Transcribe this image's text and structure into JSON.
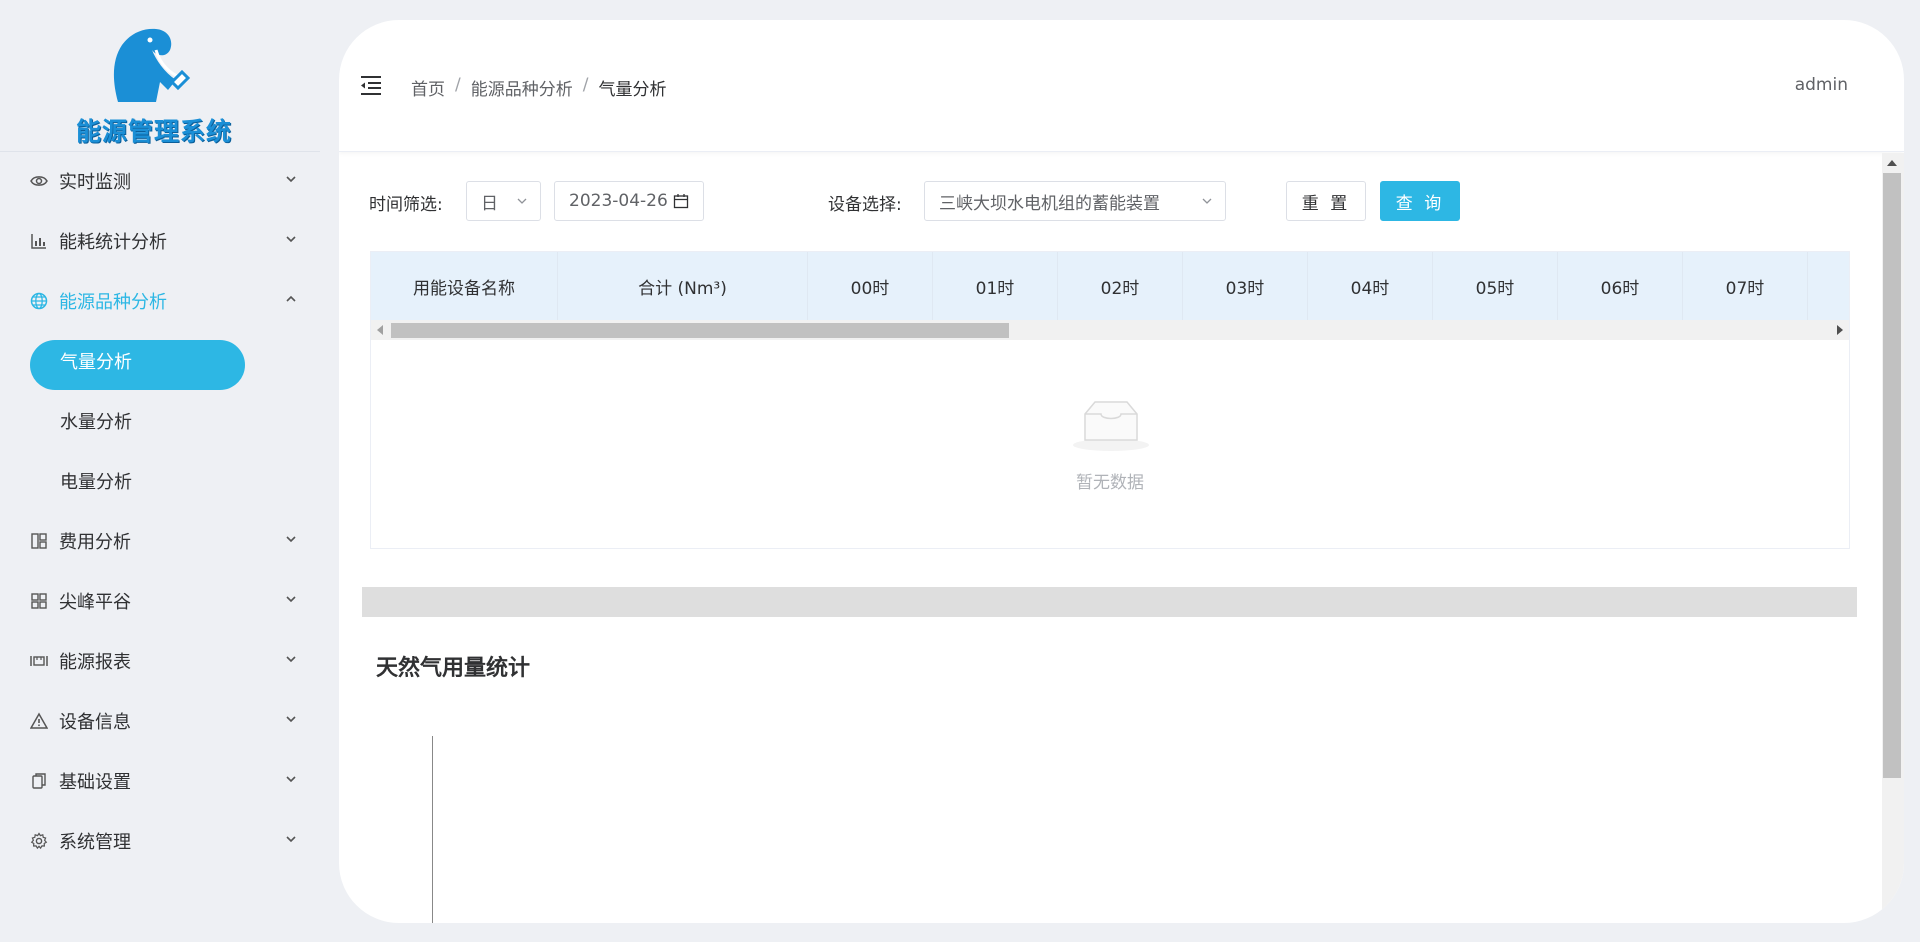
{
  "brand": {
    "name": "能源管理系统",
    "primary_color": "#2db7e4"
  },
  "sidebar": {
    "items": [
      {
        "label": "实时监测",
        "icon": "eye-icon"
      },
      {
        "label": "能耗统计分析",
        "icon": "bar-chart-icon"
      },
      {
        "label": "能源品种分析",
        "icon": "globe-icon",
        "expanded": true,
        "children": [
          {
            "label": "气量分析",
            "active": true
          },
          {
            "label": "水量分析"
          },
          {
            "label": "电量分析"
          }
        ]
      },
      {
        "label": "费用分析",
        "icon": "grid-icon"
      },
      {
        "label": "尖峰平谷",
        "icon": "apps-icon"
      },
      {
        "label": "能源报表",
        "icon": "ruler-icon"
      },
      {
        "label": "设备信息",
        "icon": "warning-triangle-icon"
      },
      {
        "label": "基础设置",
        "icon": "copy-icon"
      },
      {
        "label": "系统管理",
        "icon": "gear-icon"
      }
    ]
  },
  "header": {
    "breadcrumb": [
      "首页",
      "能源品种分析",
      "气量分析"
    ],
    "separator": "/",
    "user": "admin"
  },
  "filters": {
    "time_label": "时间筛选:",
    "time_unit": "日",
    "date": "2023-04-26",
    "device_label": "设备选择:",
    "device": "三峡大坝水电机组的蓄能装置",
    "reset_label": "重 置",
    "query_label": "查 询"
  },
  "table": {
    "columns": [
      "用能设备名称",
      "合计 (Nm³)",
      "00时",
      "01时",
      "02时",
      "03时",
      "04时",
      "05时",
      "06时",
      "07时"
    ],
    "rows": [],
    "empty_text": "暂无数据"
  },
  "section": {
    "title": "天然气用量统计"
  }
}
